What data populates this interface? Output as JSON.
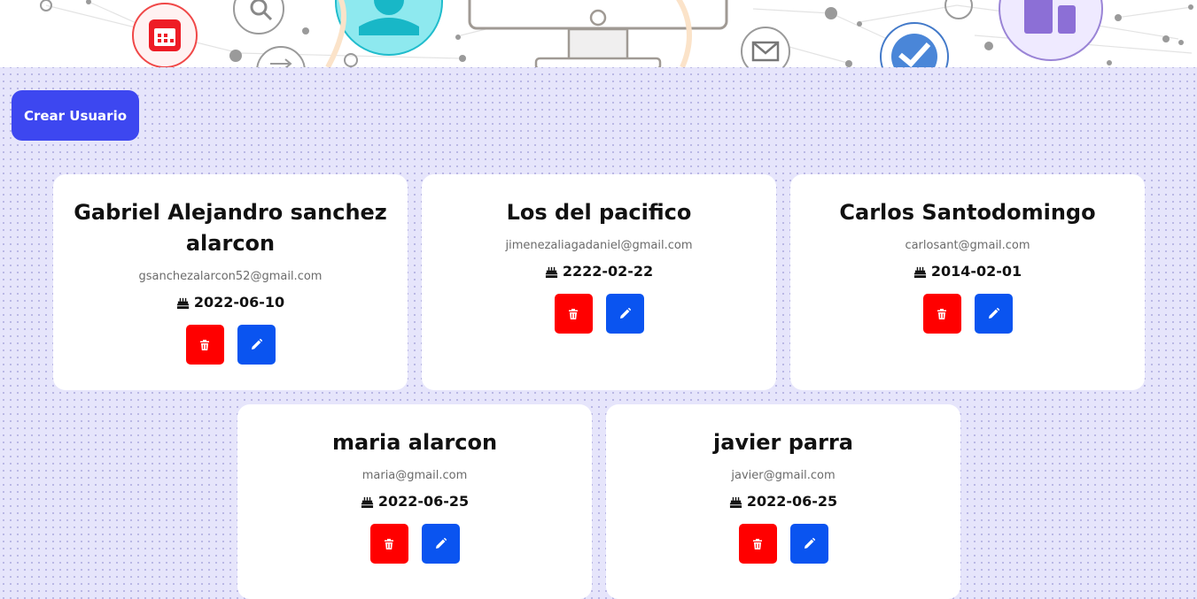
{
  "header": {
    "create_user_label": "Crear Usuario"
  },
  "colors": {
    "create_button": "#3d47f0",
    "delete_button": "#ff0000",
    "edit_button": "#0a54f0",
    "page_background": "#e6e5fb"
  },
  "users": [
    {
      "name": "Gabriel Alejandro sanchez alarcon",
      "email": "gsanchezalarcon52@gmail.com",
      "birthdate": "2022-06-10"
    },
    {
      "name": "Los del pacifico",
      "email": "jimenezaliagadaniel@gmail.com",
      "birthdate": "2222-02-22"
    },
    {
      "name": "Carlos Santodomingo",
      "email": "carlosant@gmail.com",
      "birthdate": "2014-02-01"
    },
    {
      "name": "maria alarcon",
      "email": "maria@gmail.com",
      "birthdate": "2022-06-25"
    },
    {
      "name": "javier parra",
      "email": "javier@gmail.com",
      "birthdate": "2022-06-25"
    }
  ],
  "icons": {
    "birthdate": "cake-icon",
    "delete": "trash-icon",
    "edit": "pencil-icon"
  }
}
